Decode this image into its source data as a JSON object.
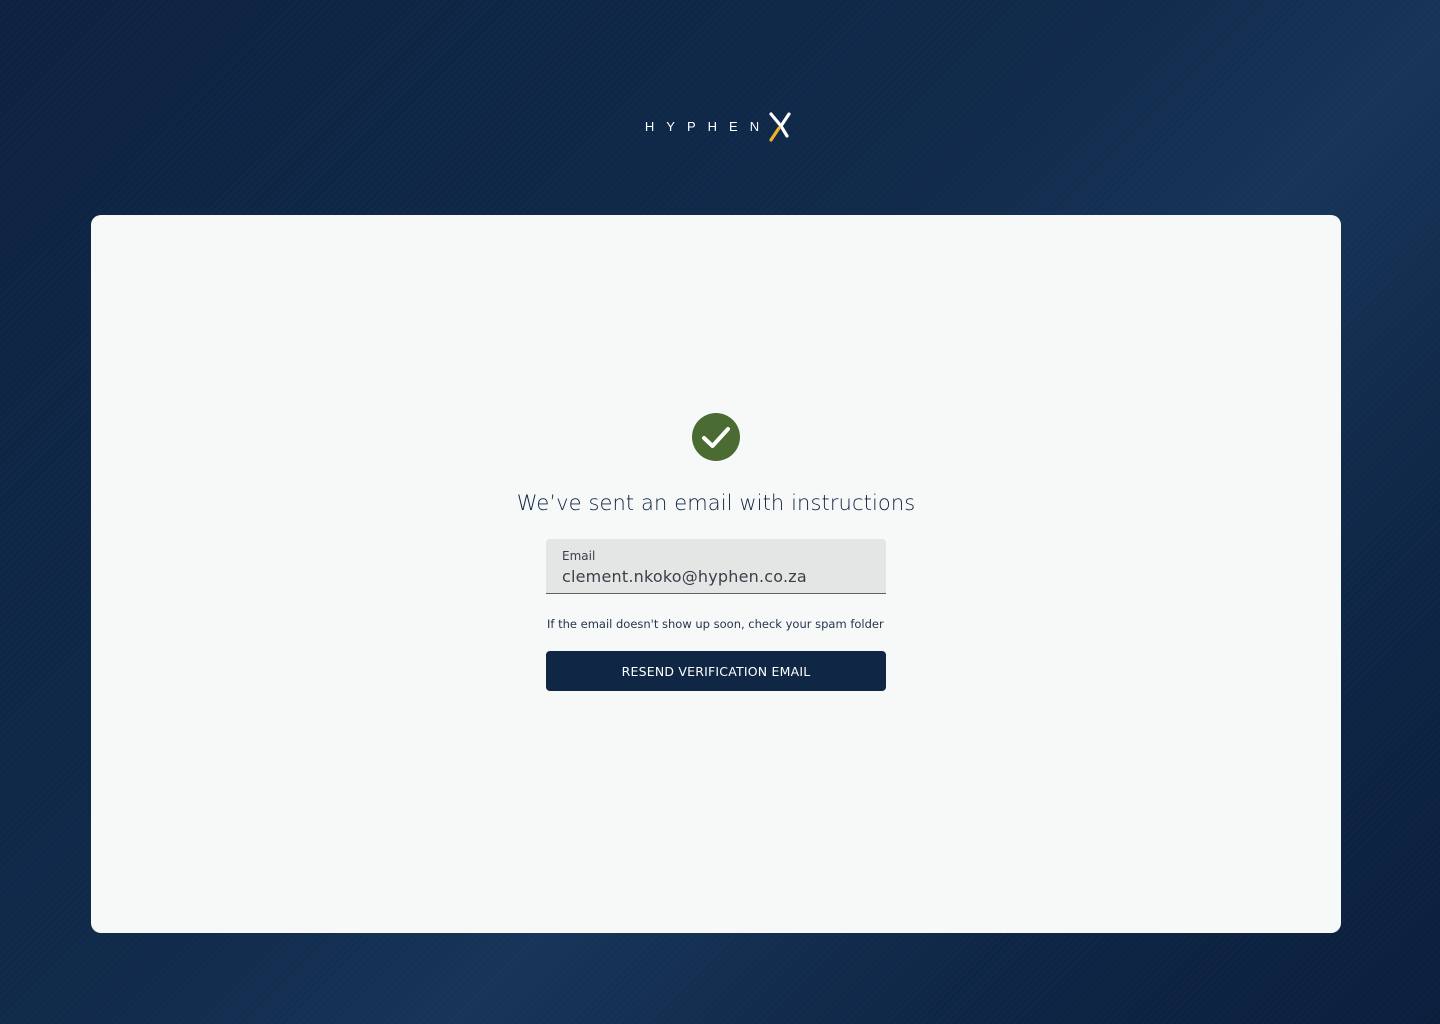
{
  "brand": {
    "logo_text": "HYPHEN",
    "logo_mark": "X",
    "colors": {
      "accent": "#f0b429",
      "primary": "#0f2744",
      "success": "#4a6b31"
    }
  },
  "confirmation": {
    "icon": "check-circle-icon",
    "heading": "We’ve sent an email with instructions",
    "email_label": "Email",
    "email_value": "clement.nkoko@hyphen.co.za",
    "hint": "If the email doesn't show up soon, check your spam folder",
    "resend_label": "RESEND VERIFICATION EMAIL"
  }
}
